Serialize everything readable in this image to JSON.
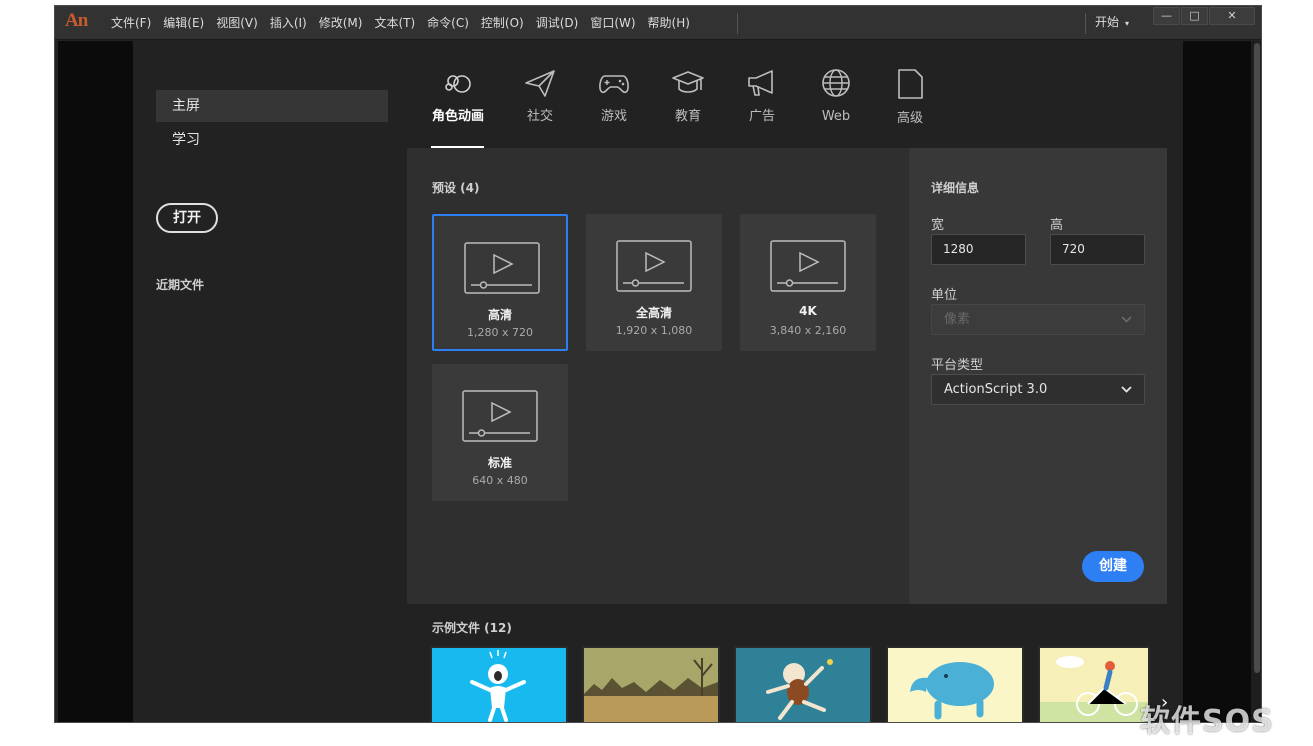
{
  "app": {
    "logo": "An",
    "menu": [
      "文件(F)",
      "编辑(E)",
      "视图(V)",
      "插入(I)",
      "修改(M)",
      "文本(T)",
      "命令(C)",
      "控制(O)",
      "调试(D)",
      "窗口(W)",
      "帮助(H)"
    ],
    "workspace": "开始",
    "workspace_caret": "▾",
    "window_minimize": "—",
    "window_restore": "□",
    "window_close": "✕"
  },
  "sidebar": {
    "items": [
      "主屏",
      "学习"
    ],
    "active": "主屏",
    "open_button": "打开",
    "recent_label": "近期文件"
  },
  "categories": {
    "items": [
      "角色动画",
      "社交",
      "游戏",
      "教育",
      "广告",
      "Web",
      "高级"
    ],
    "active": "角色动画"
  },
  "presets": {
    "title": "预设 (4)",
    "items": [
      {
        "name": "高清",
        "size": "1,280 x 720"
      },
      {
        "name": "全高清",
        "size": "1,920 x 1,080"
      },
      {
        "name": "4K",
        "size": "3,840 x 2,160"
      },
      {
        "name": "标准",
        "size": "640 x 480"
      }
    ],
    "selected": "高清"
  },
  "details": {
    "title": "详细信息",
    "width_label": "宽",
    "width_value": "1280",
    "height_label": "高",
    "height_value": "720",
    "unit_label": "单位",
    "unit_value": "像素",
    "platform_label": "平台类型",
    "platform_value": "ActionScript 3.0",
    "create_button": "创建"
  },
  "samples": {
    "title": "示例文件 (12)",
    "next": "›"
  },
  "watermark": "软件SOS",
  "colors": {
    "accent": "#2d7ff3",
    "logo": "#c65b2d"
  }
}
